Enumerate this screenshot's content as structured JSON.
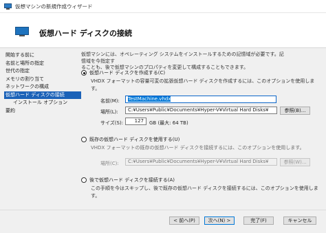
{
  "window": {
    "title": "仮想マシンの新規作成ウィザード",
    "icon": "vm-wizard-icon"
  },
  "header": {
    "title": "仮想ハード ディスクの接続",
    "icon": "virtual-disk-monitor-icon"
  },
  "nav": {
    "items": [
      {
        "label": "開始する前に"
      },
      {
        "label": "名前と場所の指定"
      },
      {
        "label": "世代の指定"
      },
      {
        "label": "メモリの割り当て"
      },
      {
        "label": "ネットワークの構成"
      },
      {
        "label": "仮想ハード ディスクの接続",
        "active": true
      },
      {
        "label": "インストール オプション",
        "sub": true
      },
      {
        "label": "要約"
      }
    ]
  },
  "content": {
    "description_line1": "仮想マシンには、オペレーティング システムをインストールするための記憶域が必要です。記憶域を今指定す",
    "description_line2": "ることも、後で仮想マシンのプロパティを変更して構成することもできます。",
    "option_create": {
      "label": "仮想ハード ディスクを作成する(C)",
      "selected": true,
      "description": "VHDX フォーマットの容量可変の拡張仮想ハード ディスクを作成するには、このオプションを使用しま",
      "description_cont": "す。",
      "name_label": "名前(M):",
      "name_value": "TestMachine.vhdx",
      "location_label": "場所(L):",
      "location_value": "C:¥Users¥Public¥Documents¥Hyper-V¥Virtual Hard Disks¥",
      "browse_label": "参照(B)...",
      "size_label": "サイズ(S):",
      "size_value": "127",
      "size_unit": "GB (最大: 64 TB)"
    },
    "option_existing": {
      "label": "既存の仮想ハード ディスクを使用する(U)",
      "selected": false,
      "description": "VHDX フォーマットの既存の仮想ハード ディスクを接続するには、このオプションを使用します。",
      "location_label": "場所(C):",
      "location_value": "C:¥Users¥Public¥Documents¥Hyper-V¥Virtual Hard Disks¥",
      "browse_label": "参照(W)..."
    },
    "option_later": {
      "label": "後で仮想ハード ディスクを接続する(A)",
      "selected": false,
      "description": "この手順を今はスキップし、後で既存の仮想ハード ディスクを接続するには、このオプションを使用しま",
      "description_cont": "す。"
    }
  },
  "footer": {
    "back_label": "< 前へ(P)",
    "next_label": "次へ(N) >",
    "finish_label": "完了(F)",
    "cancel_label": "キャンセル"
  }
}
